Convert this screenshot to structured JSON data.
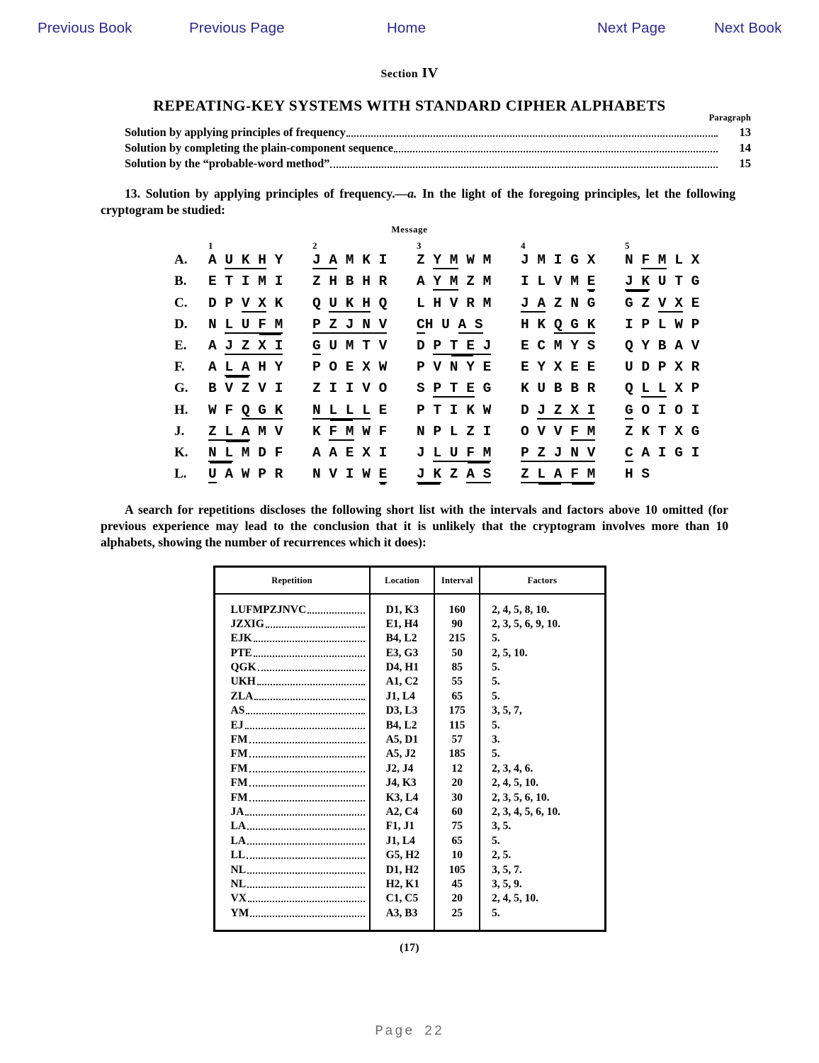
{
  "nav": {
    "previous_book": "Previous Book",
    "previous_page": "Previous Page",
    "home": "Home",
    "next_page": "Next Page",
    "next_book": "Next Book"
  },
  "document": {
    "section_word": "Section",
    "section_number": "IV",
    "section_title": "REPEATING-KEY SYSTEMS WITH STANDARD CIPHER ALPHABETS",
    "toc_header": "Paragraph",
    "toc": [
      {
        "text": "Solution by applying principles of frequency",
        "paragraph": "13"
      },
      {
        "text": "Solution by completing the plain-component sequence",
        "paragraph": "14"
      },
      {
        "text": "Solution by the “probable-word method”",
        "paragraph": "15"
      }
    ],
    "paragraph_13": {
      "number": "13.",
      "heading": "Solution by applying principles of frequency.",
      "dash_a": "—a.",
      "body": "In the light of the foregoing principles, let the following cryptogram be studied:"
    },
    "message_label": "Message",
    "column_numbers": [
      "1",
      "2",
      "3",
      "4",
      "5"
    ],
    "cipher_rows": [
      {
        "label": "A.",
        "groups": [
          "A U K H Y",
          "J A M K I",
          "Z Y M W M",
          "J M I G X",
          "N F M L X"
        ]
      },
      {
        "label": "B.",
        "groups": [
          "E T I M I",
          "Z H B H R",
          "A Y M Z M",
          "I L V M E",
          "J K U T G"
        ]
      },
      {
        "label": "C.",
        "groups": [
          "D P V X K",
          "Q U K H Q",
          "L H V R M",
          "J A Z N G",
          "G Z V X E"
        ]
      },
      {
        "label": "D.",
        "groups": [
          "N L U F M",
          "P Z J N V",
          "C H U A S",
          "H K Q G K",
          "I P L W P"
        ]
      },
      {
        "label": "E.",
        "groups": [
          "A J Z X I",
          "G U M T V",
          "D P T E J",
          "E C M Y S",
          "Q Y B A V"
        ]
      },
      {
        "label": "F.",
        "groups": [
          "A L A H Y",
          "P O E X W",
          "P V N Y E",
          "E Y X E E",
          "U D P X R"
        ]
      },
      {
        "label": "G.",
        "groups": [
          "B V Z V I",
          "Z I I V O",
          "S P T E G",
          "K U B B R",
          "Q L L X P"
        ]
      },
      {
        "label": "H.",
        "groups": [
          "W F Q G K",
          "N L L L E",
          "P T I K W",
          "D J Z X I",
          "G O I O I"
        ]
      },
      {
        "label": "J.",
        "groups": [
          "Z L A M V",
          "K F M W F",
          "N P L Z I",
          "O V V F M",
          "Z K T X G"
        ]
      },
      {
        "label": "K.",
        "groups": [
          "N L M D F",
          "A A E X I",
          "J L U F M",
          "P Z J N V",
          "C A I G I"
        ]
      },
      {
        "label": "L.",
        "groups": [
          "U A W P R",
          "N V I W E",
          "J K Z A S",
          "Z L A F M",
          "H S"
        ]
      }
    ],
    "search_paragraph": "A search for repetitions discloses the following short list with the intervals and factors above 10 omitted (for previous experience may lead to the conclusion that it is unlikely that the cryptogram involves more than 10 alphabets, showing the number of recurrences which it does):",
    "table": {
      "headers": [
        "Repetition",
        "Location",
        "Interval",
        "Factors"
      ],
      "rows": [
        {
          "repetition": "LUFMPZJNVC",
          "location": "D1, K3",
          "interval": "160",
          "factors": "2, 4, 5, 8, 10."
        },
        {
          "repetition": "JZXIG",
          "location": "E1, H4",
          "interval": "90",
          "factors": "2, 3, 5, 6, 9, 10."
        },
        {
          "repetition": "EJK",
          "location": "B4, L2",
          "interval": "215",
          "factors": "5."
        },
        {
          "repetition": "PTE",
          "location": "E3, G3",
          "interval": "50",
          "factors": "2, 5, 10."
        },
        {
          "repetition": "QGK",
          "location": "D4, H1",
          "interval": "85",
          "factors": "5."
        },
        {
          "repetition": "UKH",
          "location": "A1, C2",
          "interval": "55",
          "factors": "5."
        },
        {
          "repetition": "ZLA",
          "location": "J1, L4",
          "interval": "65",
          "factors": "5."
        },
        {
          "repetition": "AS",
          "location": "D3, L3",
          "interval": "175",
          "factors": "3, 5, 7,"
        },
        {
          "repetition": "EJ",
          "location": "B4, L2",
          "interval": "115",
          "factors": "5."
        },
        {
          "repetition": "FM",
          "location": "A5, D1",
          "interval": "57",
          "factors": "3."
        },
        {
          "repetition": "FM",
          "location": "A5, J2",
          "interval": "185",
          "factors": "5."
        },
        {
          "repetition": "FM",
          "location": "J2, J4",
          "interval": "12",
          "factors": "2, 3, 4, 6."
        },
        {
          "repetition": "FM",
          "location": "J4, K3",
          "interval": "20",
          "factors": "2, 4, 5, 10."
        },
        {
          "repetition": "FM",
          "location": "K3, L4",
          "interval": "30",
          "factors": "2, 3, 5, 6, 10."
        },
        {
          "repetition": "JA",
          "location": "A2, C4",
          "interval": "60",
          "factors": "2, 3, 4, 5, 6, 10."
        },
        {
          "repetition": "LA",
          "location": "F1, J1",
          "interval": "75",
          "factors": "3, 5."
        },
        {
          "repetition": "LA",
          "location": "J1, L4",
          "interval": "65",
          "factors": "5."
        },
        {
          "repetition": "LL",
          "location": "G5, H2",
          "interval": "10",
          "factors": "2, 5."
        },
        {
          "repetition": "NL",
          "location": "D1, H2",
          "interval": "105",
          "factors": "3, 5, 7."
        },
        {
          "repetition": "NL",
          "location": "H2, K1",
          "interval": "45",
          "factors": "3, 5, 9."
        },
        {
          "repetition": "VX",
          "location": "C1, C5",
          "interval": "20",
          "factors": "2, 4, 5, 10."
        },
        {
          "repetition": "YM",
          "location": "A3, B3",
          "interval": "25",
          "factors": "5."
        }
      ]
    },
    "folio": "(17)"
  },
  "footer": {
    "page_label": "Page 22"
  },
  "colors": {
    "nav_link": "#2a2a8c",
    "text": "#000000",
    "footer_text": "#6b6b6b",
    "background": "#ffffff"
  }
}
